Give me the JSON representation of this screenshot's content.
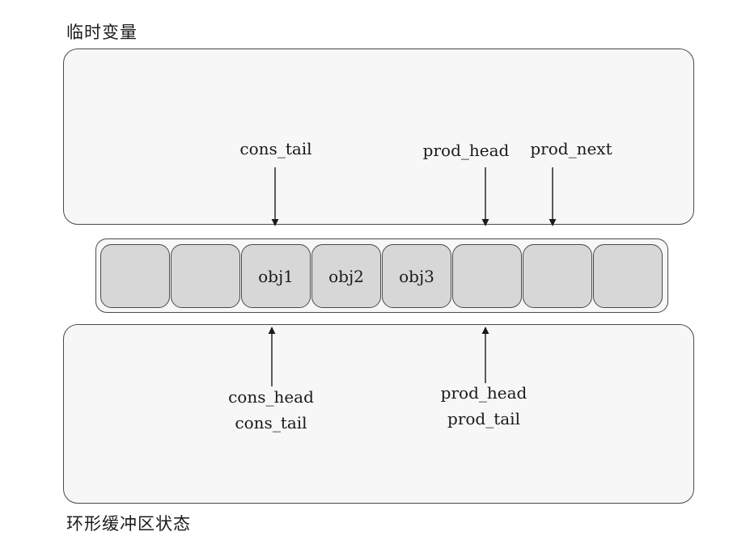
{
  "temp_section": {
    "title": "临时变量"
  },
  "state_section": {
    "title": "环形缓冲区状态"
  },
  "ring_buffer": {
    "slots": [
      "",
      "",
      "obj1",
      "obj2",
      "obj3",
      "",
      "",
      ""
    ]
  },
  "temp_pointers": {
    "cons_tail": "cons_tail",
    "prod_head": "prod_head",
    "prod_next": "prod_next"
  },
  "state_pointers": {
    "cons_head": "cons_head",
    "cons_tail": "cons_tail",
    "prod_head": "prod_head",
    "prod_tail": "prod_tail"
  }
}
